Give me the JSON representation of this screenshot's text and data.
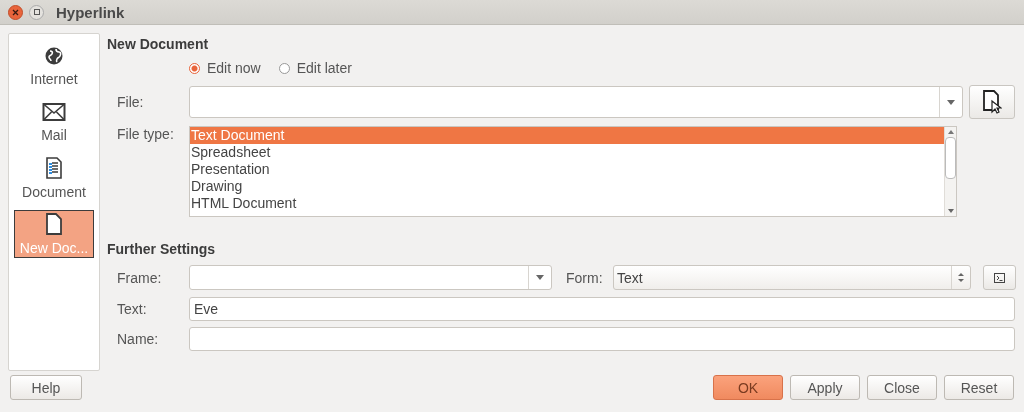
{
  "window": {
    "title": "Hyperlink"
  },
  "sidebar": {
    "items": [
      {
        "label": "Internet",
        "kind": "globe",
        "selected": false
      },
      {
        "label": "Mail",
        "kind": "envelope",
        "selected": false
      },
      {
        "label": "Document",
        "kind": "document",
        "selected": false
      },
      {
        "label": "New Doc...",
        "kind": "new-document",
        "selected": true
      }
    ]
  },
  "new_document": {
    "heading": "New Document",
    "edit_options": [
      {
        "label": "Edit now",
        "selected": true
      },
      {
        "label": "Edit later",
        "selected": false
      }
    ],
    "file_label": "File:",
    "file_type_label": "File type:",
    "file_types": [
      {
        "label": "Text Document",
        "selected": true
      },
      {
        "label": "Spreadsheet",
        "selected": false
      },
      {
        "label": "Presentation",
        "selected": false
      },
      {
        "label": "Drawing",
        "selected": false
      },
      {
        "label": "HTML Document",
        "selected": false
      }
    ]
  },
  "further_settings": {
    "heading": "Further Settings",
    "frame_label": "Frame:",
    "form_label": "Form:",
    "form_value": "Text",
    "text_label": "Text:",
    "text_value": "Eve",
    "name_label": "Name:"
  },
  "buttons": [
    {
      "label": "Help",
      "kind": "left"
    },
    {
      "label": "OK",
      "kind": "default"
    },
    {
      "label": "Apply",
      "kind": "normal"
    },
    {
      "label": "Close",
      "kind": "normal"
    },
    {
      "label": "Reset",
      "kind": "normal"
    }
  ]
}
